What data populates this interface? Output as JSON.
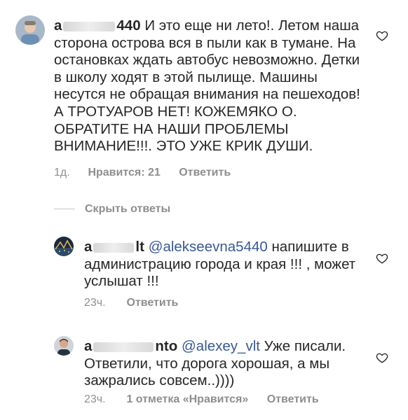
{
  "comments": [
    {
      "username_visible_start": "a",
      "username_visible_end": "440",
      "text": "И это еще ни лето!. Летом наша сторона острова вся в пыли как в тумане. На остановках ждать автобус невозможно.  Детки в школу  ходят в этой пылище. Машины  несутся не обращая внимания на пешеходов! А ТРОТУАРОВ НЕТ! КОЖЕМЯКО О.  ОБРАТИТЕ НА НАШИ ПРОБЛЕМЫ ВНИМАНИЕ!!!. ЭТО УЖЕ КРИК ДУШИ.",
      "time": "1д.",
      "likes": "Нравится: 21",
      "reply": "Ответить"
    }
  ],
  "hide_replies": "Скрыть ответы",
  "replies": [
    {
      "username_visible_start": "a",
      "username_visible_end": "lt",
      "mention": "@alekseevna5440",
      "text": "  напишите в администрацию города и края !!! , может услышат !!!",
      "time": "23ч.",
      "reply": "Ответить"
    },
    {
      "username_visible_start": "a",
      "username_visible_end": "nto",
      "mention": "@alexey_vlt",
      "text": " Уже писали. Ответили, что дорога хорошая, а мы зажрались совсем..))))",
      "time": "23ч.",
      "likes": "1 отметка «Нравится»",
      "reply": "Ответить"
    }
  ],
  "icons": {
    "heart": "heart-outline-icon"
  },
  "colors": {
    "text": "#262626",
    "meta": "#8e8e8e",
    "mention": "#385898"
  }
}
